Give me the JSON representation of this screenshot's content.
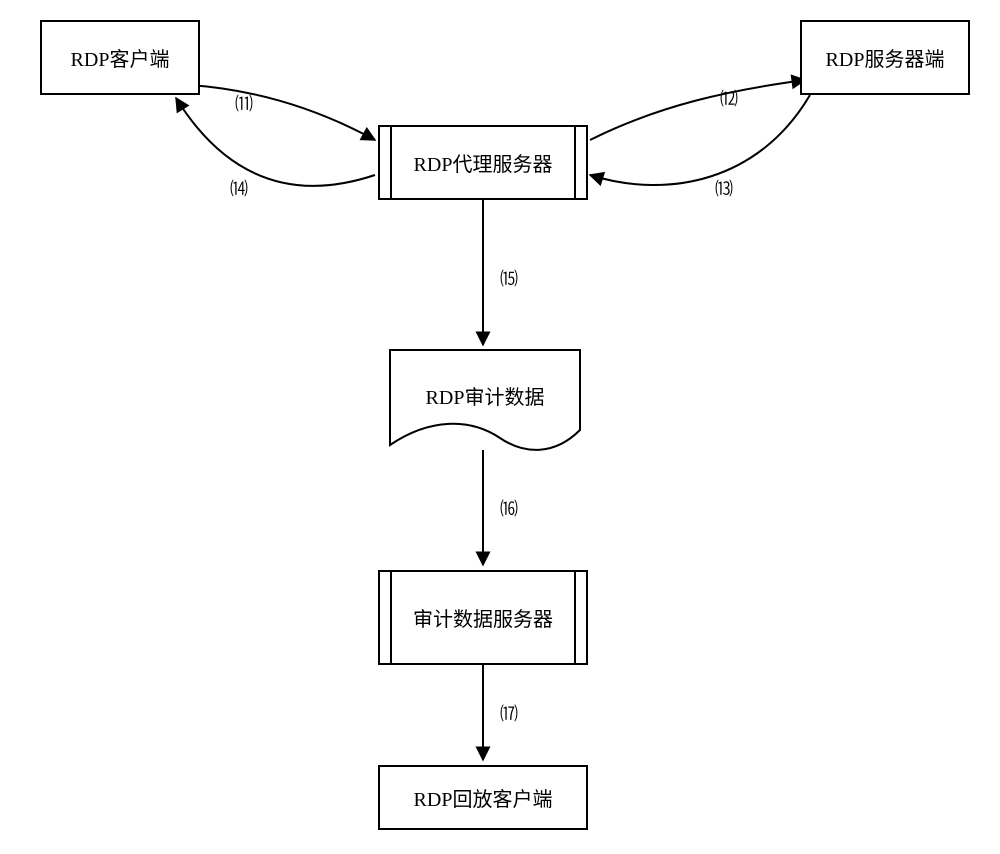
{
  "nodes": {
    "client": {
      "label": "RDP客户端"
    },
    "serverSide": {
      "label": "RDP服务器端"
    },
    "proxy": {
      "label": "RDP代理服务器"
    },
    "auditData": {
      "label": "RDP审计数据"
    },
    "auditServer": {
      "label": "审计数据服务器"
    },
    "playback": {
      "label": "RDP回放客户端"
    }
  },
  "edges": {
    "e11": {
      "label": "⑾"
    },
    "e12": {
      "label": "⑿"
    },
    "e13": {
      "label": "⒀"
    },
    "e14": {
      "label": "⒁"
    },
    "e15": {
      "label": "⒂"
    },
    "e16": {
      "label": "⒃"
    },
    "e17": {
      "label": "⒄"
    }
  },
  "chart_data": {
    "type": "flow-diagram",
    "nodes": [
      {
        "id": "client",
        "label": "RDP客户端",
        "shape": "rect"
      },
      {
        "id": "proxy",
        "label": "RDP代理服务器",
        "shape": "predefined-process"
      },
      {
        "id": "serverSide",
        "label": "RDP服务器端",
        "shape": "rect"
      },
      {
        "id": "auditData",
        "label": "RDP审计数据",
        "shape": "document"
      },
      {
        "id": "auditServer",
        "label": "审计数据服务器",
        "shape": "predefined-process"
      },
      {
        "id": "playback",
        "label": "RDP回放客户端",
        "shape": "rect"
      }
    ],
    "edges": [
      {
        "id": "11",
        "from": "client",
        "to": "proxy",
        "label": "⑾",
        "style": "curve"
      },
      {
        "id": "12",
        "from": "proxy",
        "to": "serverSide",
        "label": "⑿",
        "style": "curve"
      },
      {
        "id": "13",
        "from": "serverSide",
        "to": "proxy",
        "label": "⒀",
        "style": "curve"
      },
      {
        "id": "14",
        "from": "proxy",
        "to": "client",
        "label": "⒁",
        "style": "curve"
      },
      {
        "id": "15",
        "from": "proxy",
        "to": "auditData",
        "label": "⒂",
        "style": "straight"
      },
      {
        "id": "16",
        "from": "auditData",
        "to": "auditServer",
        "label": "⒃",
        "style": "straight"
      },
      {
        "id": "17",
        "from": "auditServer",
        "to": "playback",
        "label": "⒄",
        "style": "straight"
      }
    ]
  }
}
